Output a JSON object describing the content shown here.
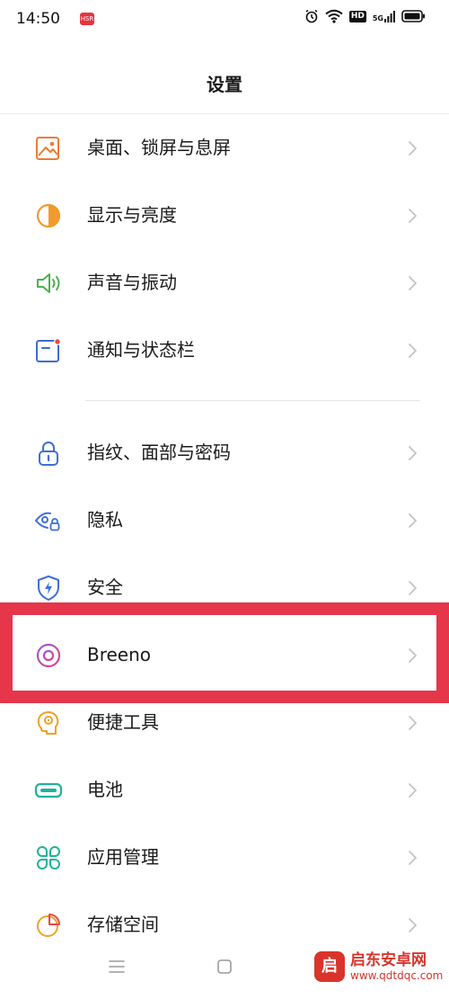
{
  "status_bar": {
    "time": "14:50",
    "app_badge": "HSR",
    "icons": [
      "alarm-icon",
      "wifi-icon",
      "hd-icon",
      "5g-signal-icon",
      "battery-icon"
    ],
    "hd": "HD",
    "network": "5G"
  },
  "title": "设置",
  "groups": [
    {
      "items": [
        {
          "label": "桌面、锁屏与息屏",
          "icon": "wallpaper-icon",
          "color": "#ee7b33"
        },
        {
          "label": "显示与亮度",
          "icon": "display-brightness-icon",
          "color": "#f09a2a"
        },
        {
          "label": "声音与振动",
          "icon": "speaker-icon",
          "color": "#4caf50"
        },
        {
          "label": "通知与状态栏",
          "icon": "notification-icon",
          "color": "#3d6bd6"
        }
      ]
    },
    {
      "items": [
        {
          "label": "指纹、面部与密码",
          "icon": "lock-icon",
          "color": "#3f6fd8"
        },
        {
          "label": "隐私",
          "icon": "privacy-eye-icon",
          "color": "#3f6fd8"
        },
        {
          "label": "安全",
          "icon": "shield-icon",
          "color": "#3f6fd8"
        },
        {
          "label": "Breeno",
          "icon": "breeno-icon",
          "color": "#c44db0",
          "highlighted": true
        },
        {
          "label": "便捷工具",
          "icon": "convenience-tools-icon",
          "color": "#f0a126"
        },
        {
          "label": "电池",
          "icon": "battery-setting-icon",
          "color": "#20b39a"
        },
        {
          "label": "应用管理",
          "icon": "app-management-icon",
          "color": "#20b39a"
        },
        {
          "label": "存储空间",
          "icon": "storage-icon",
          "color": "#f0a126"
        }
      ]
    }
  ],
  "highlight_color": "#e5364a",
  "nav_bar": [
    "menu-icon",
    "home-icon",
    "back-icon"
  ],
  "watermark": {
    "logo": "启",
    "name": "启东安卓网",
    "url": "www.qdtdqc.com"
  }
}
